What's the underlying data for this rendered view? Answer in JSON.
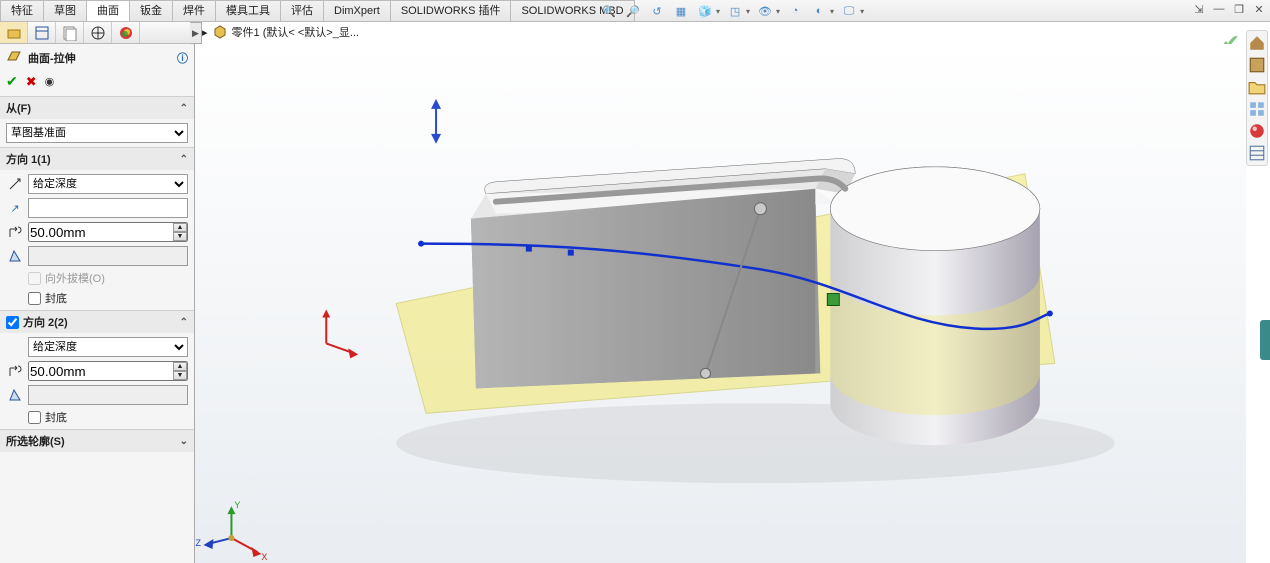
{
  "tabs": {
    "items": [
      "特征",
      "草图",
      "曲面",
      "钣金",
      "焊件",
      "模具工具",
      "评估",
      "DimXpert",
      "SOLIDWORKS 插件",
      "SOLIDWORKS MBD"
    ],
    "active_index": 2
  },
  "breadcrumb": {
    "part_label": "零件1  (默认< <默认>_显..."
  },
  "pm": {
    "title": "曲面-拉伸",
    "help_icon": "help-icon",
    "section_from": {
      "label": "从(F)",
      "value": "草图基准面"
    },
    "section_dir1": {
      "label": "方向 1(1)",
      "end_condition": "给定深度",
      "selection": "",
      "depth": "50.00mm",
      "draft_on": false,
      "draft_label": "向外拔模(O)",
      "cap_label": "封底",
      "cap_on": false
    },
    "section_dir2": {
      "label": "方向 2(2)",
      "enabled": true,
      "end_condition": "给定深度",
      "depth": "50.00mm",
      "cap_label": "封底",
      "cap_on": false
    },
    "section_contours": {
      "label": "所选轮廓(S)"
    }
  },
  "icons": {
    "feature_tree": "cube-icon",
    "property": "list-icon",
    "config": "sheet-icon",
    "display": "target-icon",
    "appearance": "sphere-icon"
  },
  "viewport": {
    "triad_labels": {
      "x": "X",
      "y": "Y",
      "z": "Z"
    }
  }
}
